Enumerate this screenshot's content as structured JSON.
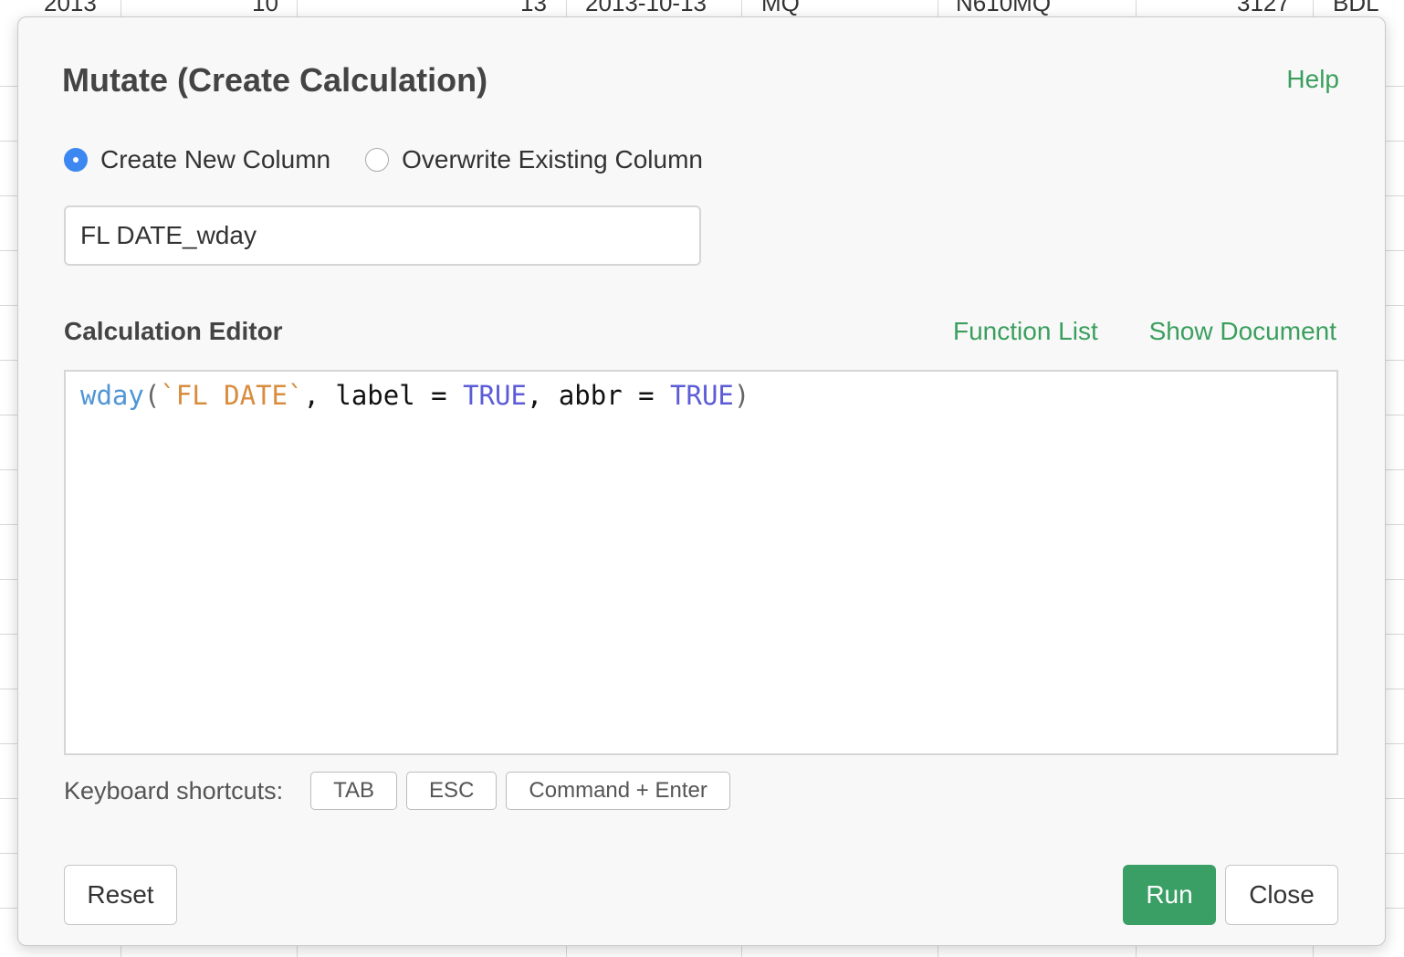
{
  "background_table": {
    "visible_row_fragment": [
      "2013",
      "10",
      "13",
      "2013-10-13",
      "MQ",
      "N610MQ",
      "3127",
      "BDL"
    ]
  },
  "dialog": {
    "title": "Mutate (Create Calculation)",
    "help_link": "Help",
    "mode_options": [
      {
        "label": "Create New Column",
        "selected": true
      },
      {
        "label": "Overwrite Existing Column",
        "selected": false
      }
    ],
    "column_name_value": "FL DATE_wday",
    "editor_label": "Calculation Editor",
    "function_list_link": "Function List",
    "show_document_link": "Show Document",
    "code_tokens": [
      {
        "text": "wday",
        "kind": "fn"
      },
      {
        "text": "(",
        "kind": "paren"
      },
      {
        "text": "`FL DATE`",
        "kind": "str"
      },
      {
        "text": ", label = ",
        "kind": "plain"
      },
      {
        "text": "TRUE",
        "kind": "kw"
      },
      {
        "text": ", abbr = ",
        "kind": "plain"
      },
      {
        "text": "TRUE",
        "kind": "kw"
      },
      {
        "text": ")",
        "kind": "paren"
      }
    ],
    "shortcuts_label": "Keyboard shortcuts:",
    "shortcut_keys": [
      "TAB",
      "ESC",
      "Command + Enter"
    ],
    "reset_label": "Reset",
    "run_label": "Run",
    "close_label": "Close"
  },
  "colors": {
    "accent_green": "#3a9f5d",
    "radio_blue": "#3c88f0",
    "code_function": "#4f96d6",
    "code_string": "#d98c3f",
    "code_keyword": "#5c5cd6"
  }
}
